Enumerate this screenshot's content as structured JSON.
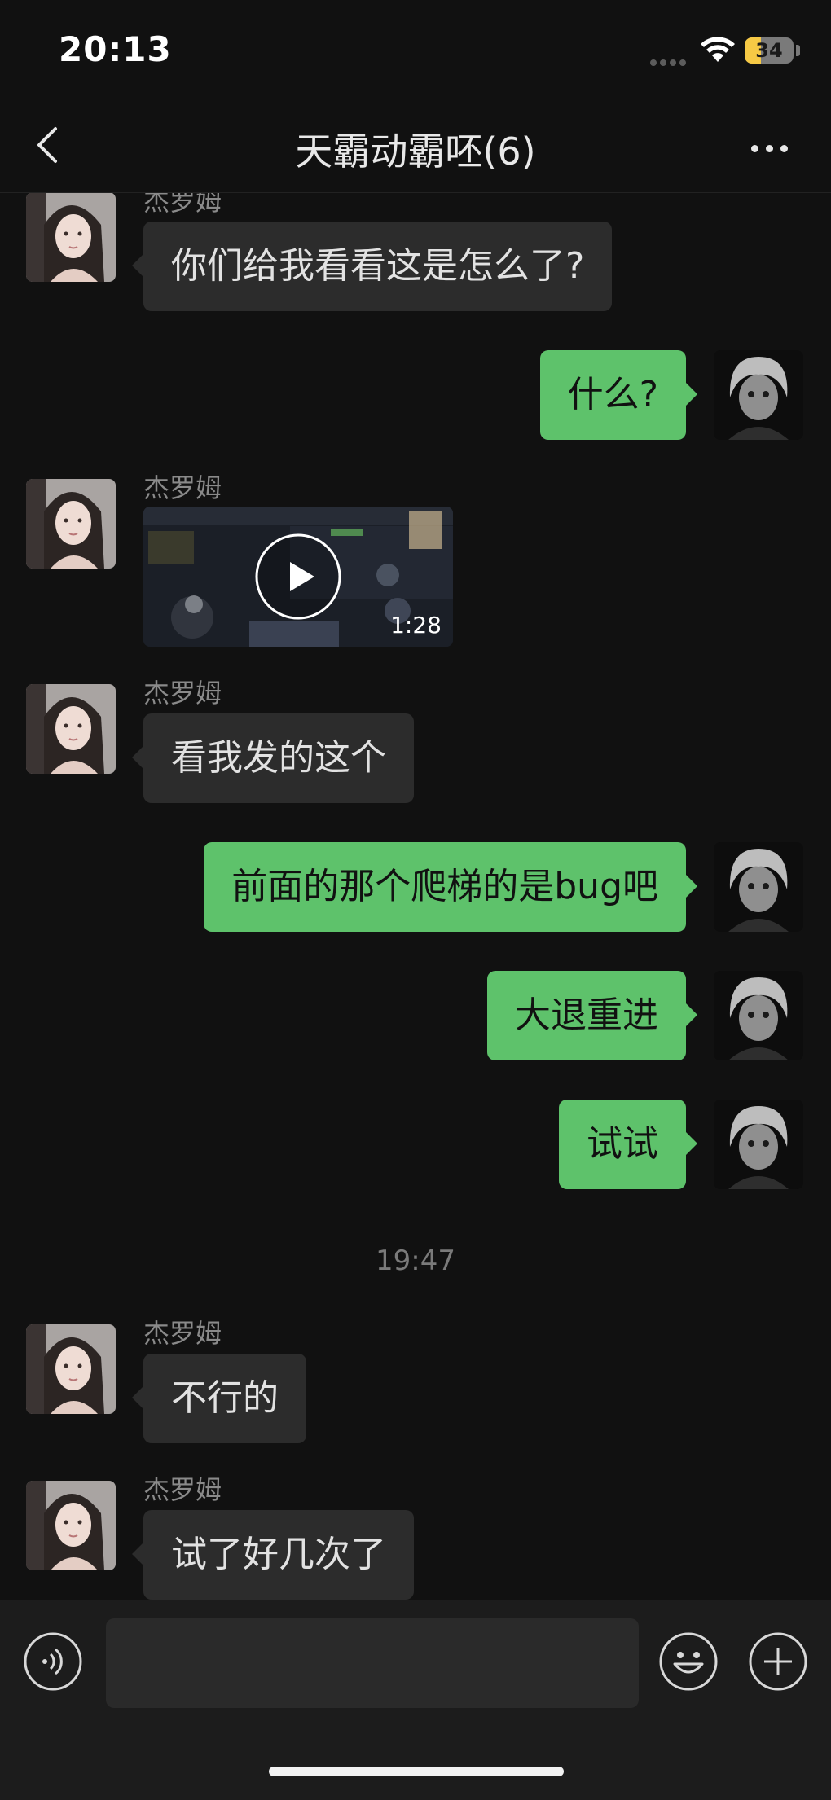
{
  "status_bar": {
    "time": "20:13",
    "battery": "34",
    "battery_level": 0.34
  },
  "header": {
    "title": "天霸动霸呸(6)"
  },
  "messages": [
    {
      "sender": "杰罗姆",
      "text": "你们给我看看这是怎么了?"
    },
    {
      "self": true,
      "text": "什么?"
    },
    {
      "sender": "杰罗姆",
      "video_duration": "1:28"
    },
    {
      "sender": "杰罗姆",
      "text": "看我发的这个"
    },
    {
      "self": true,
      "text": "前面的那个爬梯的是bug吧"
    },
    {
      "self": true,
      "text": "大退重进"
    },
    {
      "self": true,
      "text": "试试"
    },
    {
      "sender": "杰罗姆",
      "text": "不行的"
    },
    {
      "sender": "杰罗姆",
      "text": "试了好几次了"
    }
  ],
  "timestamp": "19:47",
  "icons": {
    "back": "chevron-left-icon",
    "more": "more-dots-icon",
    "voice": "voice-icon",
    "emoji": "emoji-icon",
    "add": "plus-icon",
    "play": "play-icon"
  },
  "colors": {
    "background": "#111111",
    "outgoing_bubble": "#5ec26b",
    "incoming_bubble": "#2c2c2c",
    "battery": "#f6c945"
  }
}
